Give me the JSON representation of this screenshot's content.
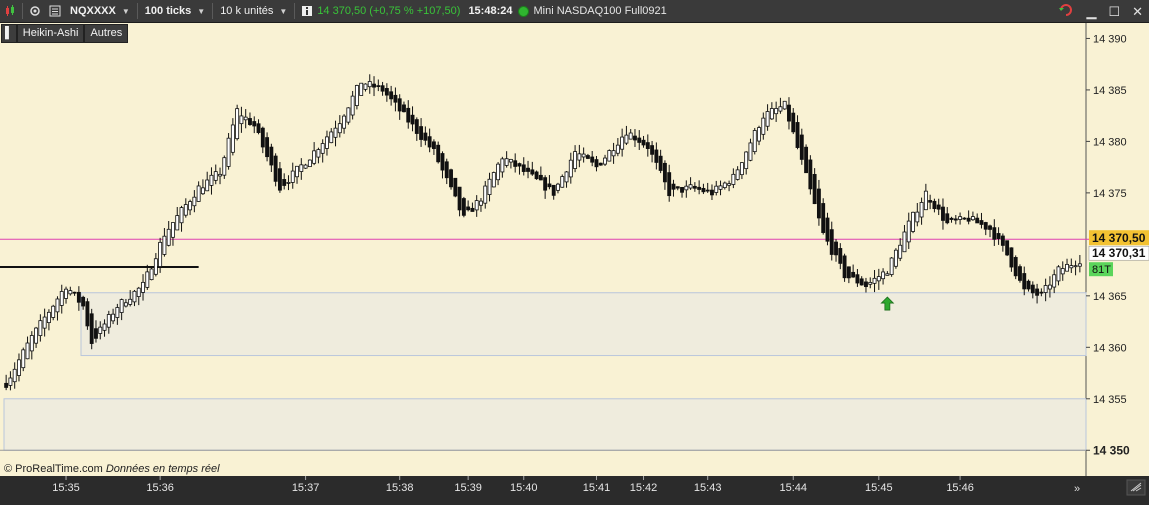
{
  "toolbar": {
    "instrument": "NQXXXX",
    "tick_mode": "100 ticks",
    "units": "10 k unités",
    "quote": "14 370,50 (+0,75 % +107,50)",
    "time": "15:48:24",
    "contract": "Mini NASDAQ100 Full0921",
    "icons": [
      "candlestick-icon",
      "settings-icon",
      "list-icon",
      "info-icon",
      "refresh-icon",
      "minimize-icon",
      "maximize-icon",
      "close-icon"
    ]
  },
  "legend": {
    "style_button": "Heikin-Ashi",
    "other_button": "Autres"
  },
  "footer": {
    "copyright": "© ProRealTime.com",
    "realtime": "Données en temps réel"
  },
  "colors": {
    "background": "#f9f2d4",
    "zone": "#efecdd",
    "pink_line": "#e040b0",
    "last_price_bg": "#f3c232",
    "ticks_badge": "#5bd55b"
  },
  "chart_data": {
    "type": "candlestick",
    "style": "Heikin-Ashi",
    "y_ticks": [
      14390,
      14385,
      14380,
      14375,
      14365,
      14360,
      14355,
      14350
    ],
    "y_tick_labels": [
      "14 390",
      "14 385",
      "14 380",
      "14 375",
      "14 365",
      "14 360",
      "14 355",
      "14 350"
    ],
    "ylim": [
      14347.5,
      14391.5
    ],
    "x_labels": [
      "15:35",
      "15:36",
      "15:37",
      "15:38",
      "15:39",
      "15:40",
      "15:41",
      "15:42",
      "15:43",
      "15:44",
      "15:45",
      "15:46"
    ],
    "x_label_positions": [
      14,
      36,
      70,
      92,
      108,
      121,
      138,
      149,
      164,
      184,
      204,
      223
    ],
    "bar_count": 252,
    "last_price": 14370.5,
    "last_price_label": "14 370,50",
    "cursor_price_label": "14 370,31",
    "ticks_remaining_label": "81T",
    "horizontal_line": 14370.5,
    "resistance_line": {
      "y": 14367.8,
      "from_bar": 0,
      "to_bar": 45
    },
    "zones": [
      {
        "from": 14359.2,
        "to": 14365.3,
        "start_bar": 18
      },
      {
        "from": 14350.0,
        "to": 14355.0,
        "start_bar": 0
      }
    ],
    "signal_arrow": {
      "bar": 206,
      "price": 14364.2,
      "direction": "up"
    },
    "path_keypoints": [
      [
        0,
        14356.5
      ],
      [
        6,
        14361
      ],
      [
        14,
        14366
      ],
      [
        18,
        14364
      ],
      [
        20,
        14360.5
      ],
      [
        26,
        14364
      ],
      [
        32,
        14366
      ],
      [
        37,
        14371
      ],
      [
        45,
        14375.5
      ],
      [
        50,
        14377
      ],
      [
        54,
        14383
      ],
      [
        58,
        14381.5
      ],
      [
        64,
        14375.5
      ],
      [
        71,
        14378.5
      ],
      [
        78,
        14382
      ],
      [
        83,
        14385.8
      ],
      [
        88,
        14385
      ],
      [
        94,
        14382
      ],
      [
        100,
        14379
      ],
      [
        107,
        14372.5
      ],
      [
        111,
        14374.5
      ],
      [
        116,
        14378.5
      ],
      [
        123,
        14376.5
      ],
      [
        128,
        14375
      ],
      [
        133,
        14379
      ],
      [
        138,
        14377.5
      ],
      [
        145,
        14381
      ],
      [
        150,
        14379.5
      ],
      [
        155,
        14375
      ],
      [
        160,
        14375.5
      ],
      [
        165,
        14375
      ],
      [
        170,
        14376.5
      ],
      [
        177,
        14382.5
      ],
      [
        182,
        14383.5
      ],
      [
        186,
        14378
      ],
      [
        191,
        14371
      ],
      [
        196,
        14367
      ],
      [
        201,
        14366
      ],
      [
        206,
        14367.5
      ],
      [
        211,
        14372
      ],
      [
        215,
        14375
      ],
      [
        220,
        14372
      ],
      [
        225,
        14372.5
      ],
      [
        230,
        14371.5
      ],
      [
        234,
        14369
      ],
      [
        238,
        14365.5
      ],
      [
        242,
        14365
      ],
      [
        246,
        14367.5
      ],
      [
        251,
        14368.5
      ]
    ]
  }
}
